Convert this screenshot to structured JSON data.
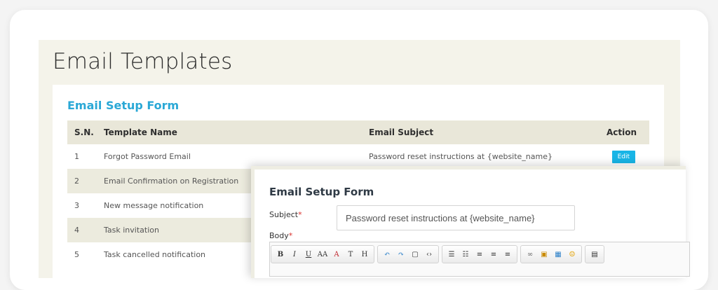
{
  "page": {
    "title": "Email Templates"
  },
  "section": {
    "title": "Email Setup Form"
  },
  "table": {
    "headers": {
      "sn": "S.N.",
      "name": "Template Name",
      "subject": "Email Subject",
      "action": "Action"
    },
    "rows": [
      {
        "sn": "1",
        "name": "Forgot Password Email",
        "subject": "Password reset instructions at {website_name}",
        "action": "Edit"
      },
      {
        "sn": "2",
        "name": "Email Confirmation on Registration",
        "subject": "",
        "action": ""
      },
      {
        "sn": "3",
        "name": "New message notification",
        "subject": "",
        "action": ""
      },
      {
        "sn": "4",
        "name": "Task invitation",
        "subject": "",
        "action": ""
      },
      {
        "sn": "5",
        "name": "Task cancelled notification",
        "subject": "",
        "action": ""
      }
    ]
  },
  "popup": {
    "title": "Email Setup Form",
    "subject_label": "Subject",
    "subject_value": "Password reset instructions at {website_name}",
    "body_label": "Body",
    "required_mark": "*"
  },
  "toolbar": {
    "groups": [
      [
        {
          "icon": "bold-icon",
          "glyph": "B"
        },
        {
          "icon": "italic-icon",
          "glyph": "I"
        },
        {
          "icon": "underline-icon",
          "glyph": "U"
        },
        {
          "icon": "font-size-icon",
          "glyph": "AA"
        },
        {
          "icon": "font-color-icon",
          "glyph": "A"
        },
        {
          "icon": "font-family-icon",
          "glyph": "T"
        },
        {
          "icon": "heading-icon",
          "glyph": "H"
        }
      ],
      [
        {
          "icon": "undo-icon",
          "glyph": "↶"
        },
        {
          "icon": "redo-icon",
          "glyph": "↷"
        },
        {
          "icon": "paste-icon",
          "glyph": "▢"
        },
        {
          "icon": "html-icon",
          "glyph": "‹›"
        }
      ],
      [
        {
          "icon": "unordered-list-icon",
          "glyph": "☰"
        },
        {
          "icon": "ordered-list-icon",
          "glyph": "☷"
        },
        {
          "icon": "align-left-icon",
          "glyph": "≡"
        },
        {
          "icon": "align-center-icon",
          "glyph": "≡"
        },
        {
          "icon": "align-right-icon",
          "glyph": "≡"
        }
      ],
      [
        {
          "icon": "link-icon",
          "glyph": "∞"
        },
        {
          "icon": "image-icon",
          "glyph": "▣"
        },
        {
          "icon": "table-icon",
          "glyph": "▦"
        },
        {
          "icon": "emoji-icon",
          "glyph": "☺"
        }
      ],
      [
        {
          "icon": "preview-icon",
          "glyph": "▤"
        }
      ]
    ]
  },
  "colors": {
    "accent": "#2aa8d6",
    "edit_button": "#18b5e6",
    "panel_bg": "#f4f3ea",
    "header_bg": "#e9e7d9",
    "required": "#d9302c"
  }
}
